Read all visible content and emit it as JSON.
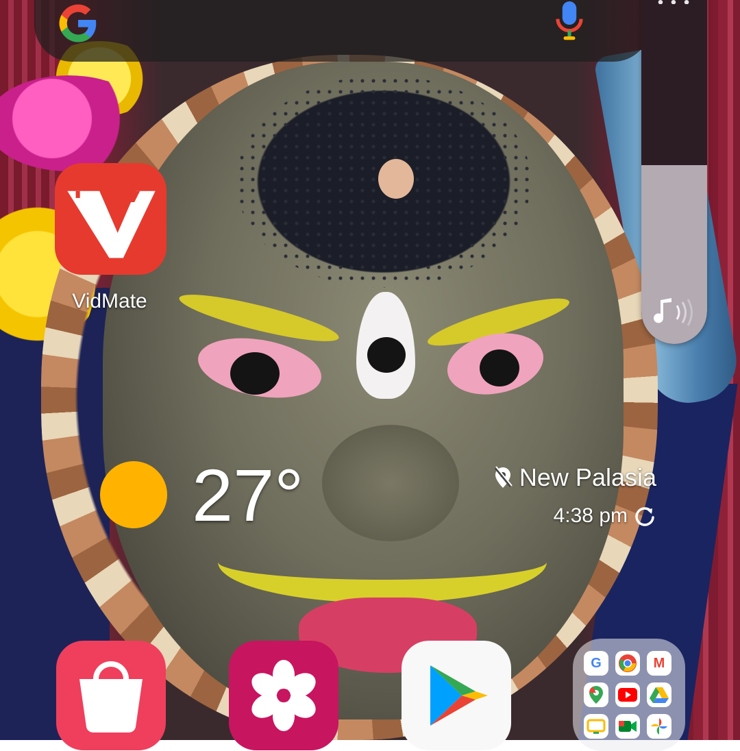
{
  "search_bar": {
    "logo_icon": "google-g-icon",
    "mic_icon": "microphone-icon"
  },
  "volume_panel": {
    "more_icon": "more-options-icon",
    "mode_icon": "music-note-icon",
    "level_fraction": 0.49
  },
  "apps": {
    "vidmate": {
      "label": "VidMate",
      "icon": "vidmate-icon",
      "color": "#e63a2e"
    }
  },
  "weather": {
    "icon": "sun-icon",
    "temperature": "27°",
    "location": "New Palasia",
    "updated_time": "4:38 pm",
    "refresh_icon": "refresh-icon",
    "location_icon": "location-off-icon"
  },
  "dock": [
    {
      "name": "Galaxy Store",
      "icon": "shopping-bag-icon",
      "color": "#ef3f5d"
    },
    {
      "name": "Gallery",
      "icon": "flower-icon",
      "color": "#c8155f"
    },
    {
      "name": "Play Store",
      "icon": "play-store-icon",
      "color": "#f8f8f8"
    },
    {
      "name": "Google",
      "icon": "folder-icon",
      "apps": [
        "google-icon",
        "chrome-icon",
        "gmail-icon",
        "maps-icon",
        "youtube-icon",
        "drive-icon",
        "tv-icon",
        "meet-icon",
        "photos-icon"
      ]
    }
  ]
}
